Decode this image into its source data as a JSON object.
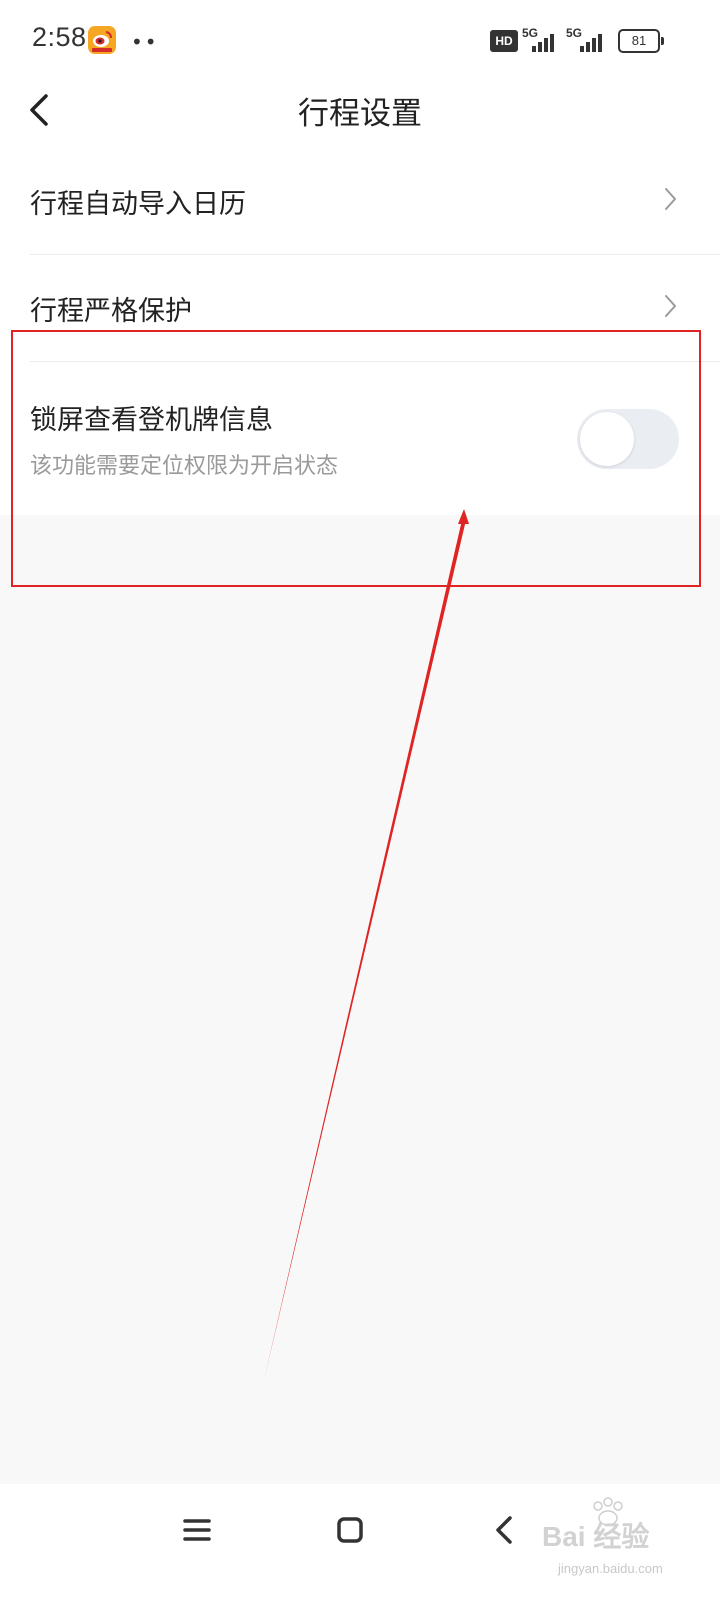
{
  "status_bar": {
    "time": "2:58",
    "dots": "••",
    "hd_label": "HD",
    "network_1": "5G",
    "network_2": "5G",
    "battery": "81",
    "app_icon": "weibo-icon"
  },
  "header": {
    "title": "行程设置",
    "back_icon": "back-arrow-icon"
  },
  "settings": {
    "items": [
      {
        "label": "行程自动导入日历",
        "type": "link",
        "icon": "chevron-right-icon"
      },
      {
        "label": "行程严格保护",
        "type": "link",
        "icon": "chevron-right-icon"
      },
      {
        "label": "锁屏查看登机牌信息",
        "sublabel": "该功能需要定位权限为开启状态",
        "type": "toggle",
        "enabled": false
      }
    ]
  },
  "nav_bar": {
    "menu_icon": "menu-icon",
    "home_icon": "home-icon",
    "back_icon": "back-icon"
  },
  "watermark": {
    "brand": "Bai 经验",
    "url": "jingyan.baidu.com"
  },
  "colors": {
    "annotation": "#e02424",
    "toggle_off": "#eaedf2",
    "background": "#f8f8f8"
  }
}
